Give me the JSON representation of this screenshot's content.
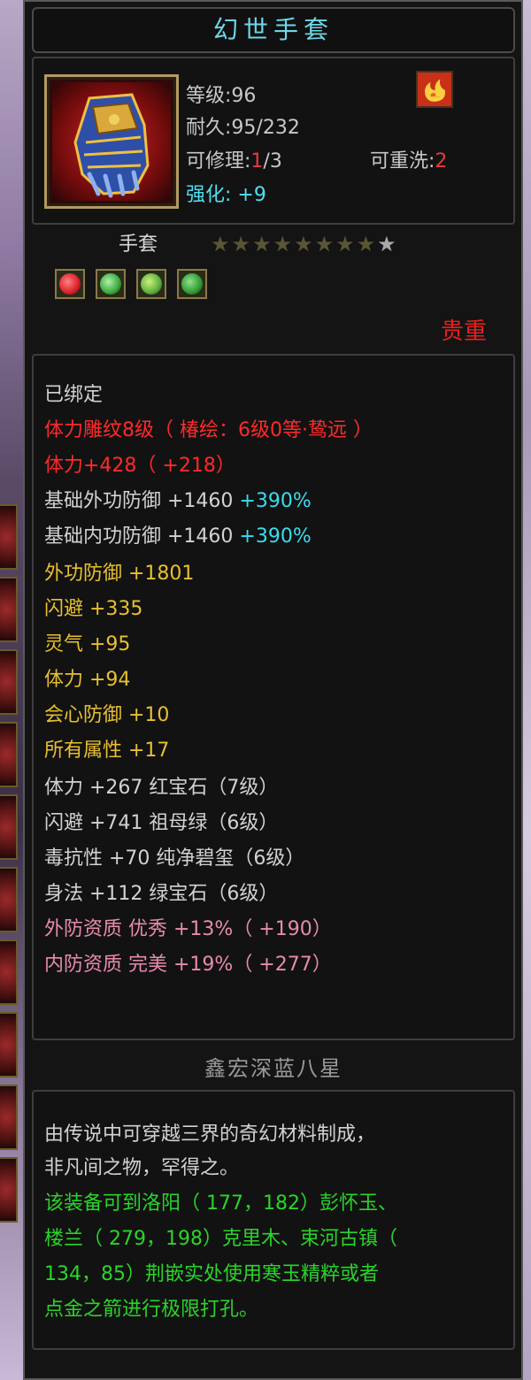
{
  "item": {
    "name": "幻世手套",
    "level_label": "等级:",
    "level_value": "96",
    "durability_label": "耐久:",
    "durability_value": "95/232",
    "repair_label": "可修理:",
    "repair_current": "1",
    "repair_max": "/3",
    "rewash_label": "可重洗:",
    "rewash_value": "2",
    "enhance_label": "强化:",
    "enhance_value": "+9",
    "type": "手套",
    "stars_total": 9,
    "stars_lit": 1,
    "rarity": "贵重",
    "icon": "gauntlet-icon",
    "attribute_icon": "fire-icon",
    "gems": [
      {
        "icon": "ruby-icon",
        "color": "#d8202a"
      },
      {
        "icon": "emerald-icon",
        "color": "#3aa83a"
      },
      {
        "icon": "jade-icon",
        "color": "#58b03a"
      },
      {
        "icon": "green-gem-icon",
        "color": "#2f9a2f"
      }
    ]
  },
  "attributes": {
    "bound": "已绑定",
    "engrave": "体力雕纹8级（ 椿绘：6级0等·鸷远 ）",
    "stamina_main": "体力+428（ +218）",
    "base_ext_def_label": "基础外功防御 +1460 ",
    "base_ext_def_pct": "+390%",
    "base_int_def_label": "基础内功防御 +1460 ",
    "base_int_def_pct": "+390%",
    "yellow_lines": [
      "外功防御 +1801",
      "闪避 +335",
      "灵气 +95",
      "体力 +94",
      "会心防御 +10",
      "所有属性 +17"
    ],
    "gem_lines": [
      "体力 +267 红宝石（7级）",
      "闪避 +741 祖母绿（6级）",
      "毒抗性 +70 纯净碧玺（6级）",
      "身法 +112 绿宝石（6级）"
    ],
    "quality_lines": [
      "外防资质  优秀 +13%（ +190）",
      "内防资质  完美 +19%（ +277）"
    ]
  },
  "set_name": "鑫宏深蓝八星",
  "description": {
    "white_lines": [
      "由传说中可穿越三界的奇幻材料制成，",
      "非凡间之物，罕得之。"
    ],
    "green_lines": [
      "该装备可到洛阳（ 177，182）彭怀玉、",
      "楼兰（ 279，198）克里木、束河古镇（",
      "134，85）荆嵌实处使用寒玉精粹或者",
      "点金之箭进行极限打孔。"
    ]
  }
}
